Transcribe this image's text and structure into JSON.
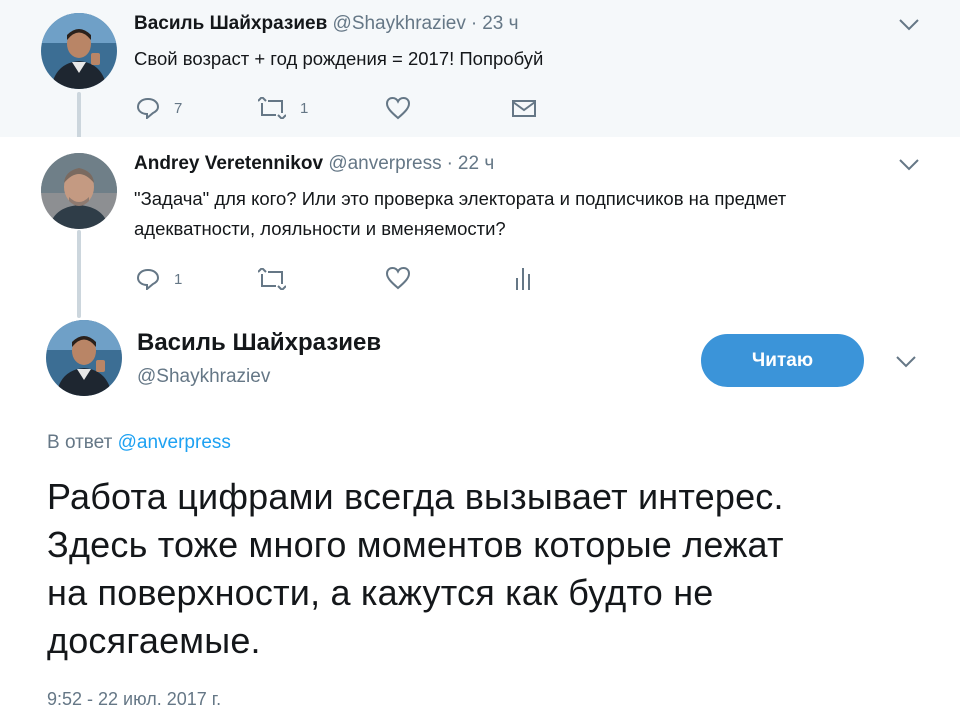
{
  "tweet1": {
    "name": "Василь Шайхразиев",
    "handle": "@Shaykhraziev",
    "separator": "·",
    "time": "23 ч",
    "text": "Свой возраст + год рождения = 2017! Попробуй",
    "reply_count": "7",
    "retweet_count": "1",
    "icons": [
      "reply-icon",
      "retweet-icon",
      "like-icon",
      "message-icon",
      "chevron-down-icon"
    ]
  },
  "tweet2": {
    "name": "Andrey Veretennikov",
    "handle": "@anverpress",
    "separator": "·",
    "time": "22 ч",
    "text_line1": "\"Задача\" для кого? Или это проверка электората и подписчиков на предмет",
    "text_line2": "адекватности, лояльности и вменяемости?",
    "reply_count": "1",
    "icons": [
      "reply-icon",
      "retweet-icon",
      "like-icon",
      "analytics-icon",
      "chevron-down-icon"
    ]
  },
  "main": {
    "name": "Василь Шайхразиев",
    "handle": "@Shaykhraziev",
    "follow_label": "Читаю",
    "reply_prefix": "В ответ",
    "reply_mention": "@anverpress",
    "text_lines": [
      "Работа цифрами всегда вызывает интерес.",
      "Здесь тоже много моментов которые лежат",
      "на поверхности, а кажутся как будто не",
      "досягаемые."
    ],
    "timestamp": "9:52 - 22 июл. 2017 г."
  },
  "colors": {
    "background_highlight": "#f5f8fa",
    "accent": "#1da1f2",
    "button": "#3b94d9",
    "secondary_text": "#657786",
    "thread_line": "#ccd6dd"
  }
}
